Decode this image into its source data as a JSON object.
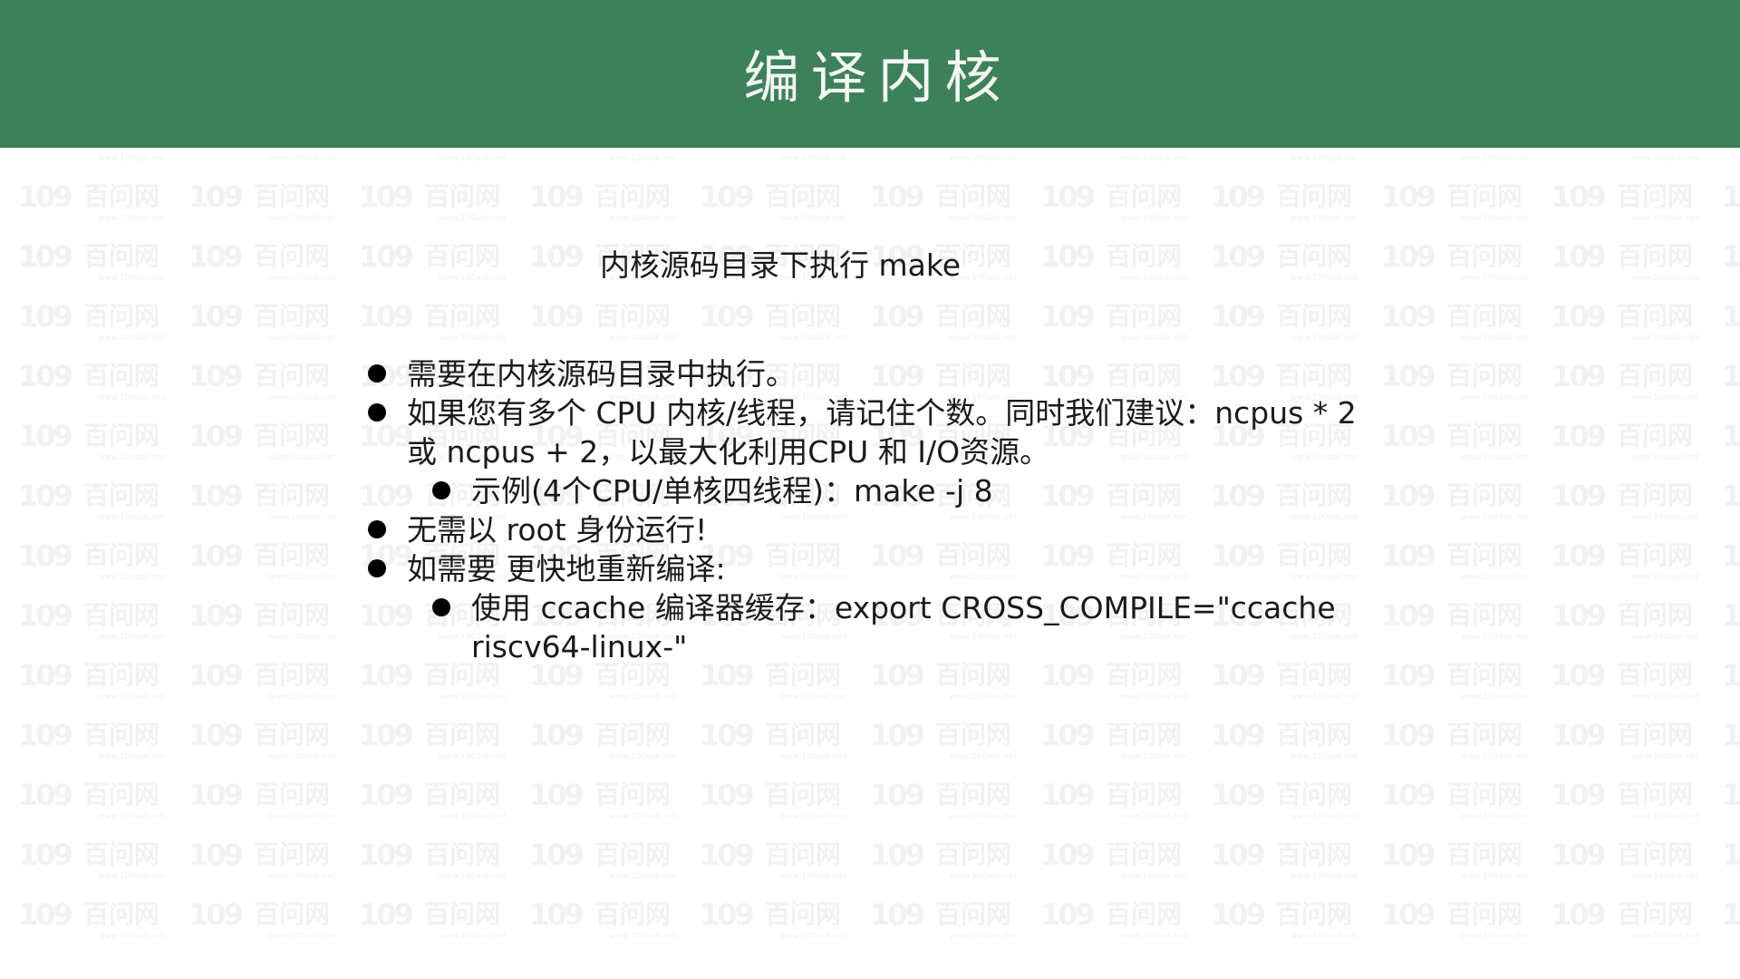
{
  "slide": {
    "title": "编译内核",
    "subtitle": "内核源码目录下执行 make",
    "bullets": [
      {
        "level": 1,
        "text": "需要在内核源码目录中执行。"
      },
      {
        "level": 1,
        "text": "如果您有多个 CPU 内核/线程，请记住个数。同时我们建议：ncpus * 2 或 ncpus + 2，以最大化利用CPU 和 I/O资源。"
      },
      {
        "level": 2,
        "text": "示例(4个CPU/单核四线程)：make -j 8"
      },
      {
        "level": 1,
        "text": "无需以 root 身份运行!"
      },
      {
        "level": 1,
        "text": "如需要 更快地重新编译:"
      },
      {
        "level": 2,
        "text": "使用 ccache 编译器缓存：export  CROSS_COMPILE=\"ccache riscv64-linux-\""
      }
    ]
  },
  "watermark": {
    "logo": "109",
    "brand": "百问网",
    "url": "www.100ask.net"
  },
  "colors": {
    "header_bg": "#3d815a",
    "header_text": "#f4f7f4",
    "body_text": "#1a1a1a",
    "bullet_dot": "#000000",
    "watermark": "#f1f1f1"
  }
}
